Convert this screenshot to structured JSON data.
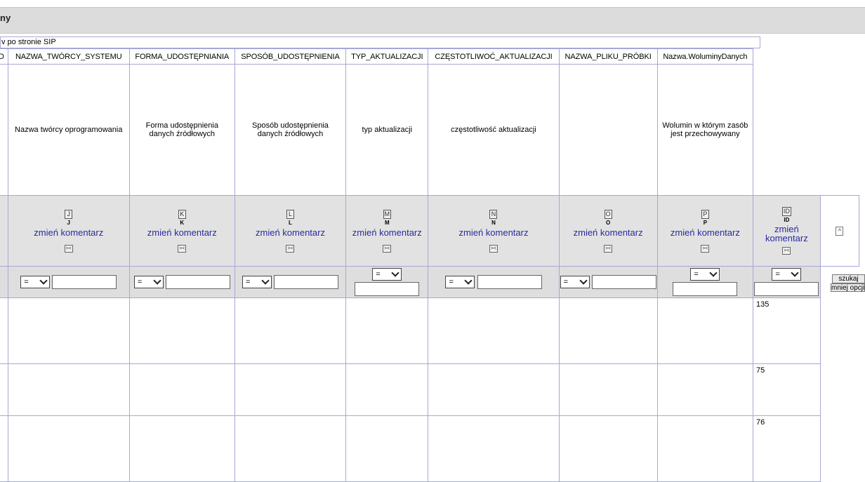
{
  "page": {
    "title": "ny",
    "caption": "v po stronie SIP"
  },
  "columns": [
    {
      "key": "c0",
      "name": "D",
      "description": "",
      "letter": "",
      "letter_sub": ""
    },
    {
      "key": "J",
      "name": "NAZWA_TWÓRCY_SYSTEMU",
      "description": "Nazwa twórcy oprogramowania",
      "letter": "J",
      "letter_sub": "J"
    },
    {
      "key": "K",
      "name": "FORMA_UDOSTĘPNIANIA",
      "description": "Forma udostępnienia danych źródłowych",
      "letter": "K",
      "letter_sub": "K"
    },
    {
      "key": "L",
      "name": "SPOSÓB_UDOSTĘPNIENIA",
      "description": "Sposób udostępnienia danych źródłowych",
      "letter": "L",
      "letter_sub": "L"
    },
    {
      "key": "M",
      "name": "TYP_AKTUALIZACJI",
      "description": "typ aktualizacji",
      "letter": "M",
      "letter_sub": "M"
    },
    {
      "key": "N",
      "name": "CZĘSTOTLIWOĆ_AKTUALIZACJI",
      "description": "częstotliwość aktualizacji",
      "letter": "N",
      "letter_sub": "N"
    },
    {
      "key": "O",
      "name": "NAZWA_PLIKU_PRÓBKI",
      "description": "",
      "letter": "O",
      "letter_sub": "O"
    },
    {
      "key": "P",
      "name": "Nazwa.WoluminyDanych",
      "description": "Wolumin w którym zasób jest przechowywany",
      "letter": "P",
      "letter_sub": "P"
    },
    {
      "key": "ID",
      "name": "",
      "description": "",
      "letter": "ID",
      "letter_sub": "ID"
    }
  ],
  "controls": {
    "comment_link": "zmień komentarz",
    "swap_label": "><",
    "sort_icon": "^"
  },
  "filter": {
    "operator": "=",
    "search_button": "szukaj",
    "less_options_button": "mniej opcji"
  },
  "rows": [
    {
      "id": "135"
    },
    {
      "id": "75"
    },
    {
      "id": "76"
    }
  ]
}
